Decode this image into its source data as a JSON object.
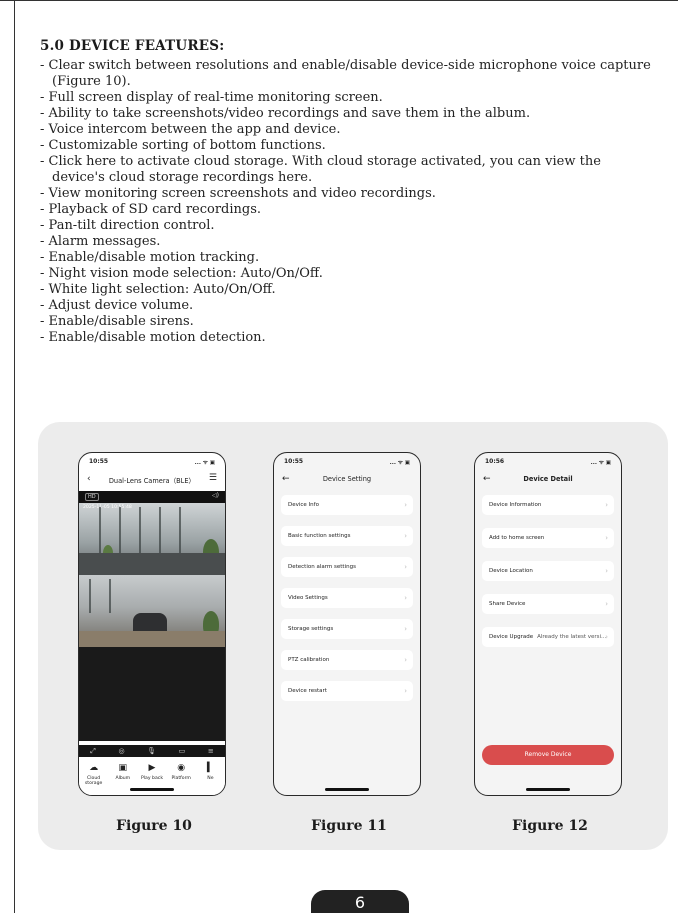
{
  "heading": "5.0 DEVICE FEATURES:",
  "features": [
    "- Clear switch between resolutions and enable/disable device-side microphone voice capture (Figure 10).",
    "- Full screen display of real-time monitoring screen.",
    "- Ability to take screenshots/video recordings and save them in the album.",
    "- Voice intercom between the app and device.",
    "- Customizable sorting of bottom functions.",
    "- Click here to activate cloud storage. With cloud storage activated, you can view the device's cloud storage recordings here.",
    "- View monitoring screen screenshots and video recordings.",
    "- Playback of SD card recordings.",
    "- Pan-tilt direction control.",
    "- Alarm messages.",
    "- Enable/disable motion tracking.",
    "- Night vision mode selection: Auto/On/Off.",
    "- White light selection: Auto/On/Off.",
    "- Adjust device volume.",
    "- Enable/disable sirens.",
    "- Enable/disable motion detection."
  ],
  "figure10": {
    "time": "10:55",
    "status_icons": "... ᯤ ▣",
    "title": "Dual-Lens Camera（BLE）",
    "hd_label": "HD",
    "timestamp": "2025-11-05  10:55:48",
    "tabs": [
      {
        "icon": "cloud-icon",
        "label": "Cloud storage"
      },
      {
        "icon": "album-icon",
        "label": "Album"
      },
      {
        "icon": "playback-icon",
        "label": "Play back"
      },
      {
        "icon": "platform-icon",
        "label": "Platform"
      },
      {
        "icon": "more-icon",
        "label": "Ne"
      }
    ]
  },
  "figure11": {
    "time": "10:55",
    "status_icons": "... ᯤ ▣",
    "title": "Device Setting",
    "items": [
      "Device Info",
      "Basic function settings",
      "Detection alarm settings",
      "Video Settings",
      "Storage settings",
      "PTZ calibration",
      "Device restart"
    ]
  },
  "figure12": {
    "time": "10:56",
    "status_icons": "... ᯤ ▣",
    "title": "Device Detail",
    "items": [
      "Device Information",
      "Add to home screen",
      "Device Location",
      "Share Device",
      "Device Upgrade"
    ],
    "upgrade_status": "Already the latest versi...",
    "remove_label": "Remove Device"
  },
  "captions": [
    "Figure 10",
    "Figure 11",
    "Figure 12"
  ],
  "page_number": "6"
}
